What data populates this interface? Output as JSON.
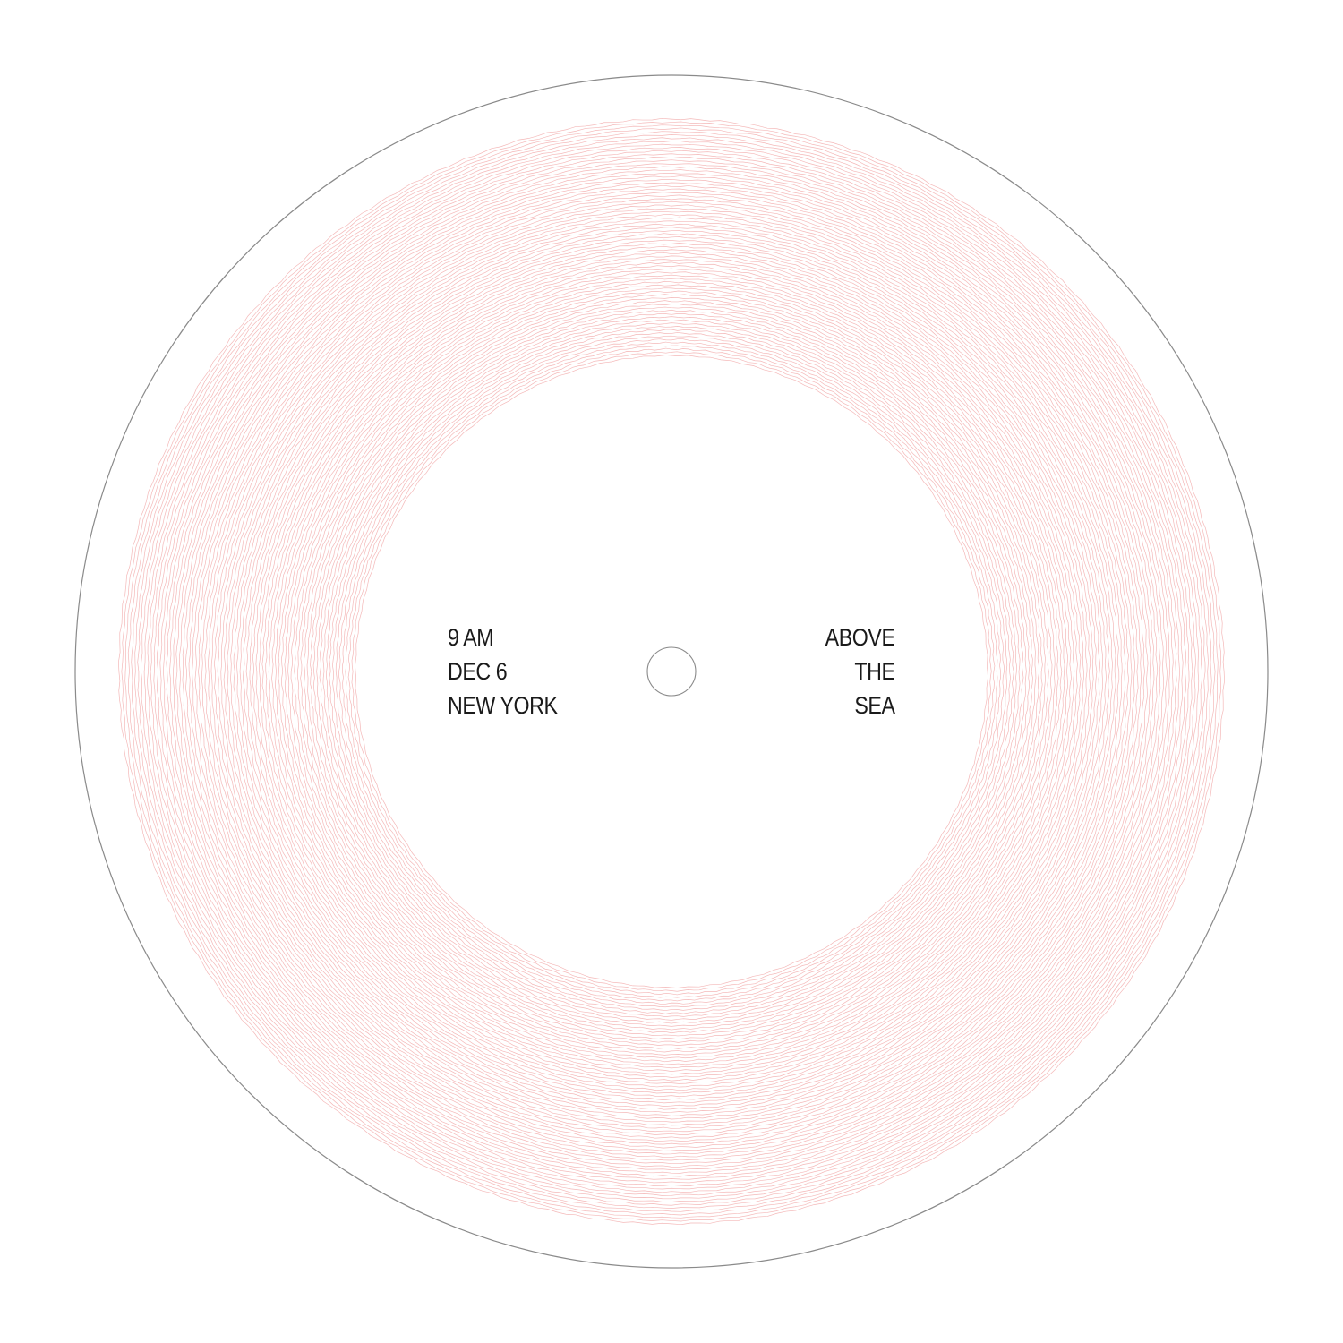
{
  "colors": {
    "background": "#ffffff",
    "outer_ring": "#8a8a8a",
    "groove": "#f4b8b8",
    "text": "#1a1a1a",
    "spindle_ring": "#8a8a8a"
  },
  "record": {
    "groove_count": 75
  },
  "label": {
    "left_lines": [
      "9 AM",
      "DEC 6",
      "NEW YORK"
    ],
    "right_lines": [
      "ABOVE",
      "THE",
      "SEA"
    ]
  }
}
